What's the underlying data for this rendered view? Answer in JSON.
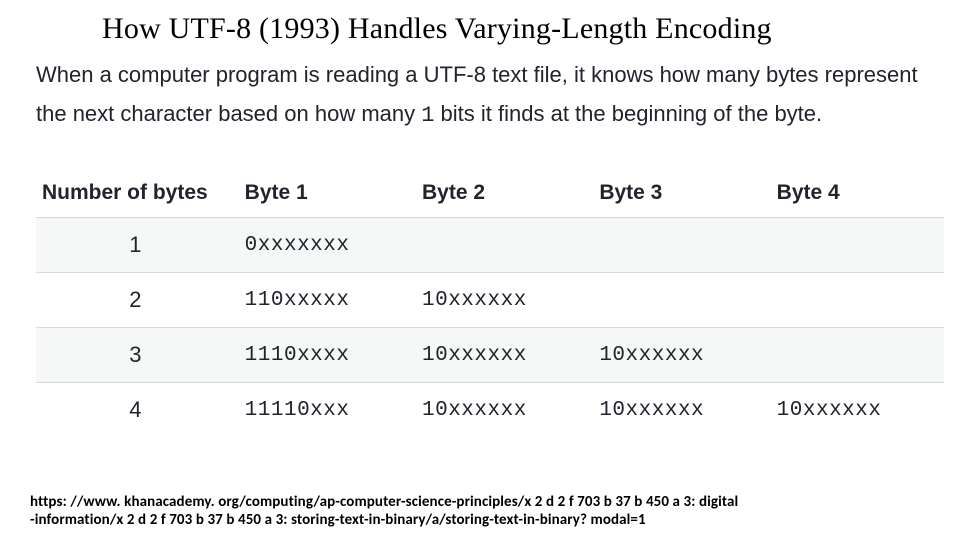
{
  "title": "How UTF-8 (1993)  Handles Varying-Length Encoding",
  "intro": {
    "part1": "When a computer program is reading a UTF-8 text file, it knows how many bytes represent the next character based on how many ",
    "code": "1",
    "part2": " bits it finds at the beginning of the byte."
  },
  "table": {
    "headers": {
      "num": "Number of bytes",
      "b1": "Byte 1",
      "b2": "Byte 2",
      "b3": "Byte 3",
      "b4": "Byte 4"
    },
    "rows": [
      {
        "num": "1",
        "b1": "0xxxxxxx",
        "b2": "",
        "b3": "",
        "b4": ""
      },
      {
        "num": "2",
        "b1": "110xxxxx",
        "b2": "10xxxxxx",
        "b3": "",
        "b4": ""
      },
      {
        "num": "3",
        "b1": "1110xxxx",
        "b2": "10xxxxxx",
        "b3": "10xxxxxx",
        "b4": ""
      },
      {
        "num": "4",
        "b1": "11110xxx",
        "b2": "10xxxxxx",
        "b3": "10xxxxxx",
        "b4": "10xxxxxx"
      }
    ]
  },
  "source": {
    "line1": "https: //www. khanacademy. org/computing/ap-computer-science-principles/x 2 d 2 f 703 b 37 b 450 a 3: digital",
    "line2": "-information/x 2 d 2 f 703 b 37 b 450 a 3: storing-text-in-binary/a/storing-text-in-binary? modal=1"
  }
}
